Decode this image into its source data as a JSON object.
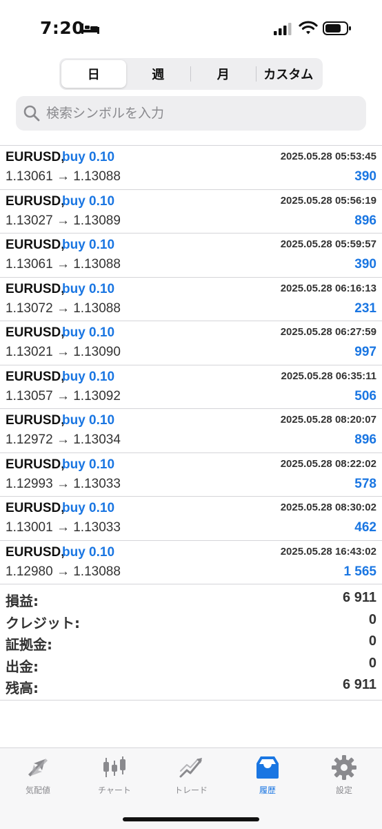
{
  "status_bar": {
    "time": "7:20"
  },
  "segments": [
    {
      "label": "日",
      "active": true
    },
    {
      "label": "週",
      "active": false
    },
    {
      "label": "月",
      "active": false
    },
    {
      "label": "カスタム",
      "active": false
    }
  ],
  "search": {
    "placeholder": "検索シンボルを入力"
  },
  "deals": [
    {
      "symbol": "EURUSD,",
      "side": "buy 0.10",
      "time": "2025.05.28 05:53:45",
      "prices": "1.13061 → 1.13088",
      "profit": "390"
    },
    {
      "symbol": "EURUSD,",
      "side": "buy 0.10",
      "time": "2025.05.28 05:56:19",
      "prices": "1.13027 → 1.13089",
      "profit": "896"
    },
    {
      "symbol": "EURUSD,",
      "side": "buy 0.10",
      "time": "2025.05.28 05:59:57",
      "prices": "1.13061 → 1.13088",
      "profit": "390"
    },
    {
      "symbol": "EURUSD,",
      "side": "buy 0.10",
      "time": "2025.05.28 06:16:13",
      "prices": "1.13072 → 1.13088",
      "profit": "231"
    },
    {
      "symbol": "EURUSD,",
      "side": "buy 0.10",
      "time": "2025.05.28 06:27:59",
      "prices": "1.13021 → 1.13090",
      "profit": "997"
    },
    {
      "symbol": "EURUSD,",
      "side": "buy 0.10",
      "time": "2025.05.28 06:35:11",
      "prices": "1.13057 → 1.13092",
      "profit": "506"
    },
    {
      "symbol": "EURUSD,",
      "side": "buy 0.10",
      "time": "2025.05.28 08:20:07",
      "prices": "1.12972 → 1.13034",
      "profit": "896"
    },
    {
      "symbol": "EURUSD,",
      "side": "buy 0.10",
      "time": "2025.05.28 08:22:02",
      "prices": "1.12993 → 1.13033",
      "profit": "578"
    },
    {
      "symbol": "EURUSD,",
      "side": "buy 0.10",
      "time": "2025.05.28 08:30:02",
      "prices": "1.13001 → 1.13033",
      "profit": "462"
    },
    {
      "symbol": "EURUSD,",
      "side": "buy 0.10",
      "time": "2025.05.28 16:43:02",
      "prices": "1.12980 → 1.13088",
      "profit": "1 565"
    }
  ],
  "summary": [
    {
      "label": "損益:",
      "value": "6 911"
    },
    {
      "label": "クレジット:",
      "value": "0"
    },
    {
      "label": "証拠金:",
      "value": "0"
    },
    {
      "label": "出金:",
      "value": "0"
    },
    {
      "label": "残高:",
      "value": "6 911"
    }
  ],
  "tabs": [
    {
      "label": "気配値",
      "icon": "quotes-icon",
      "active": false
    },
    {
      "label": "チャート",
      "icon": "candlestick-chart-icon",
      "active": false
    },
    {
      "label": "トレード",
      "icon": "trade-line-icon",
      "active": false
    },
    {
      "label": "履歴",
      "icon": "history-inbox-icon",
      "active": true
    },
    {
      "label": "設定",
      "icon": "gear-icon",
      "active": false
    }
  ],
  "colors": {
    "accent": "#1a76e2",
    "inactive": "#8a8a8e"
  }
}
